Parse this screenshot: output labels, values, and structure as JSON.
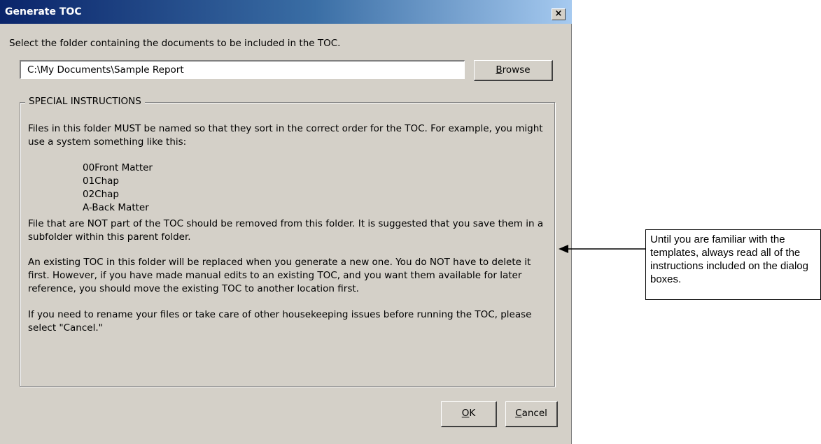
{
  "window": {
    "title": "Generate TOC",
    "close_glyph": "×"
  },
  "folder": {
    "prompt": "Select the folder containing the documents to be included in the TOC.",
    "path_value": "C:\\My Documents\\Sample Report",
    "browse_label": "Browse"
  },
  "instructions": {
    "heading": "SPECIAL INSTRUCTIONS",
    "para1": "Files in this folder MUST be named so that they sort in the correct order for the TOC. For example, you might use a system something like this:",
    "examples": [
      "00Front Matter",
      "01Chap",
      "02Chap",
      "A-Back Matter"
    ],
    "para2": "File that are NOT part of the TOC should be removed from this folder. It is suggested that you save them in a subfolder within this parent folder.",
    "para3": "An existing TOC in this folder will be replaced when you generate a new one. You do NOT have to delete it first. However, if you have made manual edits to an existing TOC, and you want them available for later reference, you should move the existing TOC to another location first.",
    "para4": "If you need to rename your files or take care of other housekeeping issues before running the TOC, please select \"Cancel.\""
  },
  "buttons": {
    "ok_label": "OK",
    "cancel_label": "Cancel"
  },
  "callout": {
    "text": "Until you are familiar with the templates, always read all of the instructions included on the dialog boxes."
  },
  "colors": {
    "dialog_bg": "#d4d0c8",
    "title_start": "#0a246a",
    "title_end": "#a6caf0"
  }
}
